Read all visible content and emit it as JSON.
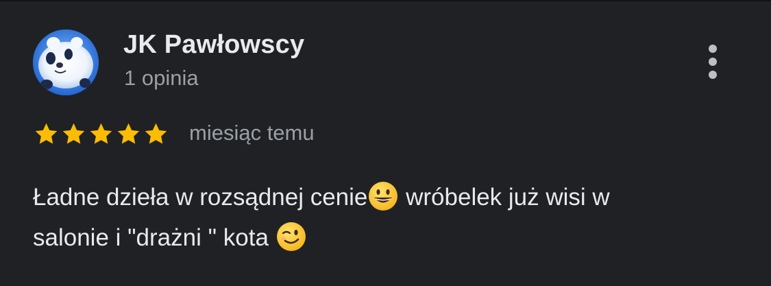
{
  "review": {
    "author_name": "JK Pawłowscy",
    "review_count": "1 opinia",
    "rating": 5,
    "rating_max": 5,
    "date": "miesiąc temu",
    "text": {
      "line1_part1": "Ładne dzieła w rozsądnej cenie",
      "line1_part2": " wróbelek już wisi w",
      "line2_part1": "salonie i \"drażni \" kota ",
      "emoji1": "grinning-face-emoji",
      "emoji2": "winking-face-emoji"
    },
    "icons": {
      "avatar": "panda-plush-photo",
      "more": "more-vert-icon",
      "star": "star-icon"
    }
  },
  "colors": {
    "background": "#202124",
    "primary_text": "#e8eaed",
    "secondary_text": "#9aa0a6",
    "star": "#fbbc04",
    "menu_dots": "#bdc1c6"
  }
}
